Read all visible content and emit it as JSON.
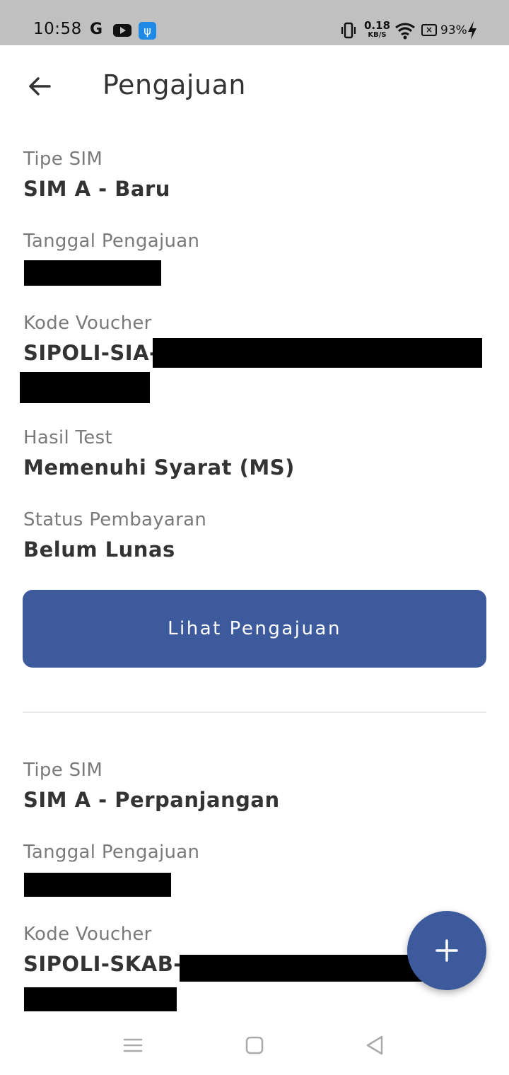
{
  "status_bar": {
    "time": "10:58",
    "google_glyph": "G",
    "usb_glyph": "ψ",
    "net_speed": "0.18",
    "net_unit": "KB/S",
    "battery_pct": "93%",
    "icons": [
      "google-icon",
      "youtube-icon",
      "usb-icon",
      "vibrate-icon",
      "wifi-icon",
      "battery-saver-icon",
      "charging-icon"
    ]
  },
  "app_bar": {
    "title": "Pengajuan",
    "back_icon": "arrow-left-icon"
  },
  "submissions": [
    {
      "tipe_sim_label": "Tipe SIM",
      "tipe_sim_value": "SIM A - Baru",
      "tanggal_label": "Tanggal Pengajuan",
      "kode_voucher_label": "Kode Voucher",
      "kode_voucher_prefix": "SIPOLI-SIA-",
      "hasil_test_label": "Hasil Test",
      "hasil_test_value": "Memenuhi Syarat (MS)",
      "status_pembayaran_label": "Status Pembayaran",
      "status_pembayaran_value": "Belum Lunas",
      "button_label": "Lihat Pengajuan"
    },
    {
      "tipe_sim_label": "Tipe SIM",
      "tipe_sim_value": "SIM A - Perpanjangan",
      "tanggal_label": "Tanggal Pengajuan",
      "kode_voucher_label": "Kode Voucher",
      "kode_voucher_prefix": "SIPOLI-SKAB-"
    }
  ],
  "fab": {
    "icon": "plus-icon"
  },
  "nav_bar": {
    "icons": [
      "menu-icon",
      "home-icon",
      "back-icon"
    ]
  },
  "colors": {
    "primary": "#3c5a9c",
    "status_bar_bg": "#c0c0c0",
    "label_text": "#7a7a7a",
    "value_text": "#333333"
  }
}
